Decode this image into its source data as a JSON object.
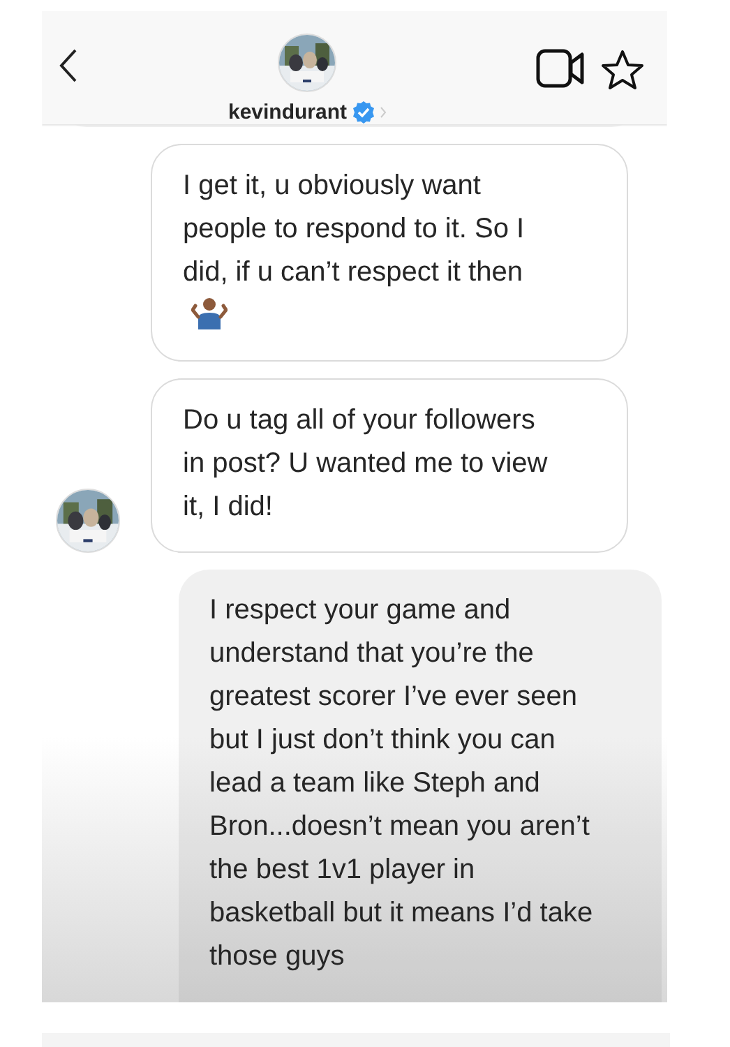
{
  "header": {
    "username": "kevindurant",
    "verified": true
  },
  "messages": [
    {
      "kind": "cut"
    },
    {
      "kind": "received",
      "text": "I get it, u obviously want people to respond to it. So I did, if u can’t respect it then",
      "shrug_emoji": true,
      "avatar": false
    },
    {
      "kind": "received",
      "text": "Do u tag all of your followers in post? U wanted me to view it, I did!",
      "avatar": true
    },
    {
      "kind": "sent",
      "text": "I respect your game and understand that you’re the greatest scorer I’ve ever seen but I just don’t think you can lead a team like Steph and Bron...doesn’t mean you aren’t the best 1v1 player in basketball but it means I’d take those guys"
    }
  ]
}
